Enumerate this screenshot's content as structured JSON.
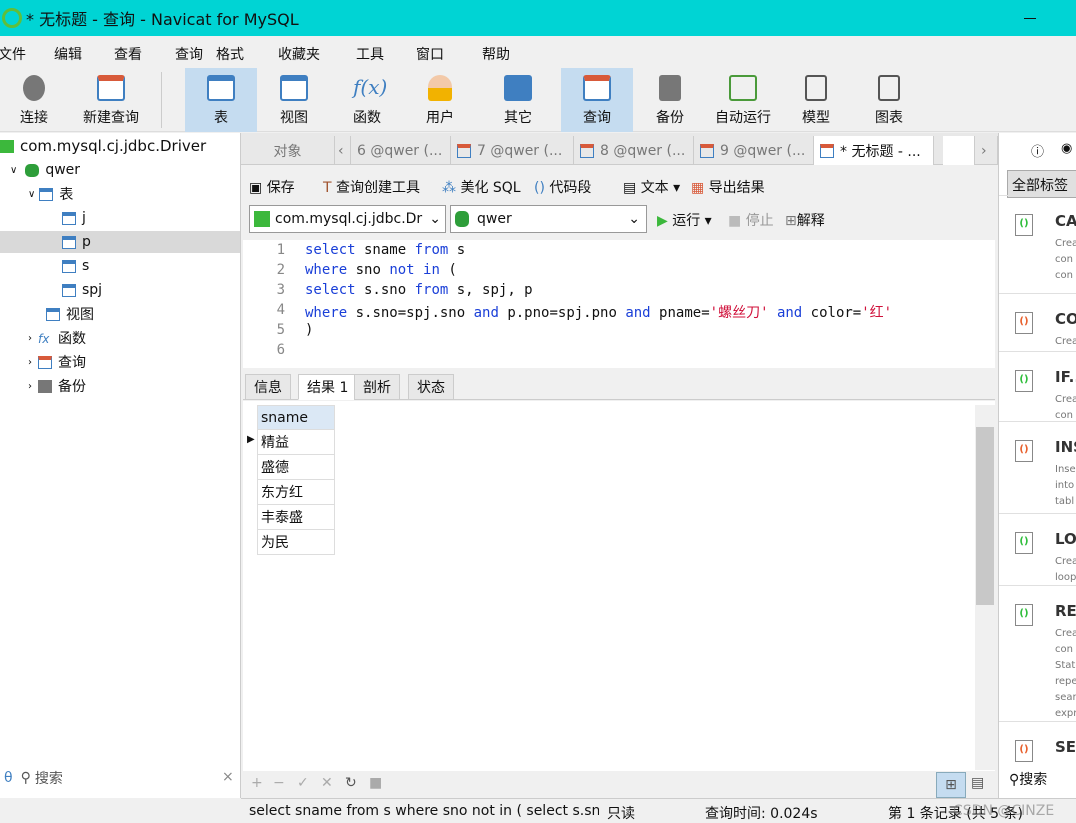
{
  "window": {
    "title": "* 无标题 - 查询 - Navicat for MySQL"
  },
  "menu": [
    "文件",
    "编辑",
    "查看",
    "查询",
    "格式",
    "收藏夹",
    "工具",
    "窗口",
    "帮助"
  ],
  "toolbar": [
    "连接",
    "新建查询",
    "表",
    "视图",
    "函数",
    "用户",
    "其它",
    "查询",
    "备份",
    "自动运行",
    "模型",
    "图表"
  ],
  "sidebar": {
    "connection": "com.mysql.cj.jdbc.Driver",
    "database": "qwer",
    "tables_label": "表",
    "tables": [
      "j",
      "p",
      "s",
      "spj"
    ],
    "selected_table": "p",
    "others": [
      "视图",
      "函数",
      "查询",
      "备份"
    ],
    "search_placeholder": "搜索"
  },
  "tabs": [
    "对象",
    "6 @qwer (...",
    "7 @qwer (...",
    "8 @qwer (...",
    "9 @qwer (...",
    "* 无标题 - ..."
  ],
  "editor_toolbar": {
    "save": "保存",
    "builder": "查询创建工具",
    "beautify": "美化 SQL",
    "snippet": "代码段",
    "text": "文本",
    "export": "导出结果",
    "run": "运行",
    "stop": "停止",
    "explain": "解释"
  },
  "connection_select": "com.mysql.cj.jdbc.Dr",
  "database_select": "qwer",
  "code_lines": [
    "select sname from s",
    "where sno not in (",
    "select s.sno from s, spj, p",
    "where s.sno=spj.sno and p.pno=spj.pno and pname='螺丝刀' and color='红'",
    ")",
    ""
  ],
  "result_tabs": [
    "信息",
    "结果 1",
    "剖析",
    "状态"
  ],
  "result": {
    "column": "sname",
    "rows": [
      "精益",
      "盛德",
      "东方红",
      "丰泰盛",
      "为民"
    ]
  },
  "status": {
    "sql": "select sname from s where sno not in ( select s.sn",
    "mode": "只读",
    "time": "查询时间: 0.024s",
    "record": "第 1 条记录 (共 5 条)"
  },
  "right_panel": {
    "filter": "全部标签",
    "search": "搜索",
    "snippets": [
      {
        "h": "CA",
        "d": "Crea\ncon\ncon",
        "color": "green"
      },
      {
        "h": "CO",
        "d": "Crea",
        "color": "multi"
      },
      {
        "h": "IF..",
        "d": "Crea\ncon",
        "color": "green"
      },
      {
        "h": "INS",
        "d": "Inse\ninto\ntabl",
        "color": "multi"
      },
      {
        "h": "LO",
        "d": "Crea\nloop",
        "color": "green"
      },
      {
        "h": "REI",
        "d": "Crea\ncon\nState\nrepe\nsear\nexpr",
        "color": "green"
      },
      {
        "h": "SEl",
        "d": "",
        "color": "multi"
      }
    ]
  },
  "watermark": "CSDN @CINZE"
}
